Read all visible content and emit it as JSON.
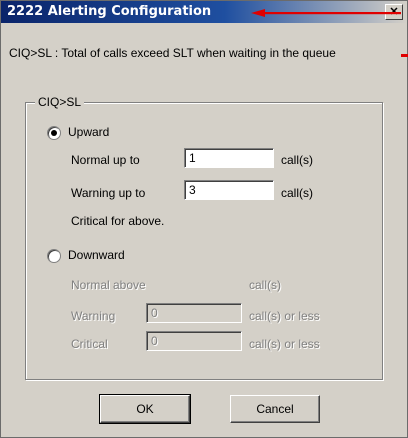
{
  "window": {
    "title": "2222 Alerting Configuration",
    "close_label": "✕"
  },
  "description": "CIQ>SL  : Total of calls exceed SLT when waiting in the queue",
  "group": {
    "legend": "CIQ>SL",
    "upward": {
      "label": "Upward",
      "selected": true,
      "normal_label": "Normal up to",
      "normal_value": "1",
      "normal_unit": "call(s)",
      "warning_label": "Warning up to",
      "warning_value": "3",
      "warning_unit": "call(s)",
      "critical_text": "Critical for above."
    },
    "downward": {
      "label": "Downward",
      "selected": false,
      "normal_label": "Normal above",
      "normal_unit": "call(s)",
      "warning_label": "Warning",
      "warning_value": "0",
      "warning_unit": "call(s) or less",
      "critical_label": "Critical",
      "critical_value": "0",
      "critical_unit": "call(s) or less"
    }
  },
  "buttons": {
    "ok": "OK",
    "cancel": "Cancel"
  },
  "colors": {
    "annotation_arrow": "#e00000",
    "titlebar": "#0a246a"
  }
}
